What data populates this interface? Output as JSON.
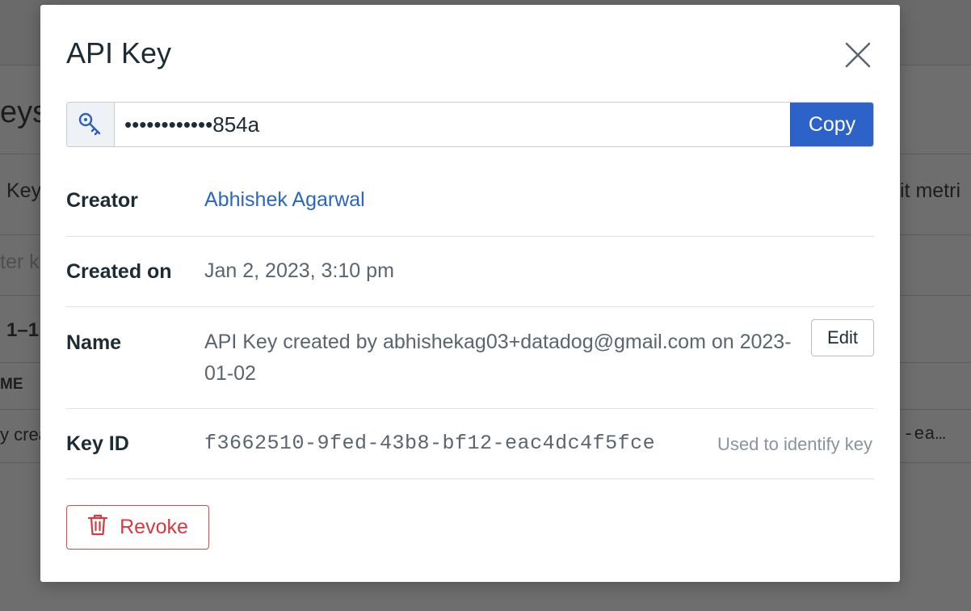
{
  "background": {
    "title_fragment": "eys",
    "key_fragment": "Key",
    "filter_fragment": "ter k",
    "range_fragment": "1–1",
    "column_fragment": "ME",
    "cell_fragment": "y crea",
    "right_fragment_1": "it metri",
    "right_fragment_2": "-ea…"
  },
  "modal": {
    "title": "API Key",
    "close_icon": "close-icon",
    "key_icon": "key-icon",
    "masked_key": "••••••••••••854a",
    "copy_label": "Copy",
    "details": {
      "creator_label": "Creator",
      "creator_value": "Abhishek Agarwal",
      "created_on_label": "Created on",
      "created_on_value": "Jan 2, 2023, 3:10 pm",
      "name_label": "Name",
      "name_value": "API Key created by abhishekag03+datadog@gmail.com on 2023-01-02",
      "edit_label": "Edit",
      "key_id_label": "Key ID",
      "key_id_value": "f3662510-9fed-43b8-bf12-eac4dc4f5fce",
      "key_id_hint": "Used to identify key"
    },
    "revoke_label": "Revoke",
    "revoke_icon": "trash-icon"
  },
  "colors": {
    "primary": "#2d63c8",
    "link": "#2a66c2",
    "danger": "#d23b41",
    "overlay": "#6f6f6f"
  }
}
